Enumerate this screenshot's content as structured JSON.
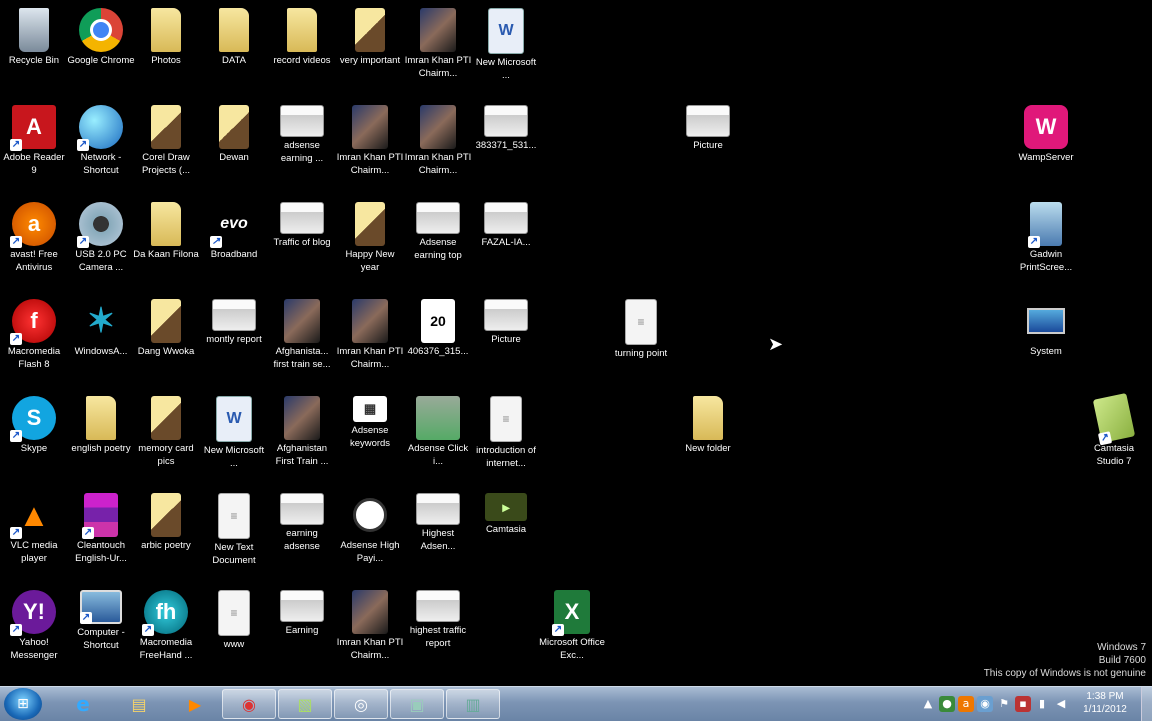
{
  "desktop": {
    "icons": [
      {
        "label": "Recycle Bin",
        "icon": "recycle-bin-icon"
      },
      {
        "label": "Google Chrome",
        "icon": "chrome-icon"
      },
      {
        "label": "Photos",
        "icon": "folder-icon"
      },
      {
        "label": "DATA",
        "icon": "folder-icon"
      },
      {
        "label": "record videos",
        "icon": "folder-icon"
      },
      {
        "label": "very important",
        "icon": "folder-icon"
      },
      {
        "label": "Imran Khan PTI Chairm...",
        "icon": "photo-icon"
      },
      {
        "label": "New Microsoft ...",
        "icon": "word-document-icon"
      },
      {
        "label": "Adobe Reader 9",
        "icon": "acrobat-icon"
      },
      {
        "label": "Network - Shortcut",
        "icon": "network-icon"
      },
      {
        "label": "Corel Draw Projects (...",
        "icon": "folder-icon"
      },
      {
        "label": "Dewan",
        "icon": "folder-icon"
      },
      {
        "label": "adsense earning ...",
        "icon": "thumbnail-icon"
      },
      {
        "label": "Imran Khan PTI Chairm...",
        "icon": "photo-icon"
      },
      {
        "label": "Imran Khan PTI Chairm...",
        "icon": "photo-icon"
      },
      {
        "label": "383371_531...",
        "icon": "thumbnail-icon"
      },
      {
        "label": "avast! Free Antivirus",
        "icon": "avast-icon"
      },
      {
        "label": "USB 2.0 PC Camera ...",
        "icon": "webcam-icon"
      },
      {
        "label": "Da Kaan Filona",
        "icon": "folder-icon"
      },
      {
        "label": "Broadband",
        "icon": "evo-icon"
      },
      {
        "label": "Traffic of blog",
        "icon": "thumbnail-icon"
      },
      {
        "label": "Happy New year",
        "icon": "folder-icon"
      },
      {
        "label": "Adsense earning top",
        "icon": "thumbnail-icon"
      },
      {
        "label": "FAZAL-IA...",
        "icon": "thumbnail-icon"
      },
      {
        "label": "Macromedia Flash 8",
        "icon": "flash-icon"
      },
      {
        "label": "WindowsA...",
        "icon": "star-icon"
      },
      {
        "label": "Dang Wwoka",
        "icon": "folder-icon"
      },
      {
        "label": "montly report",
        "icon": "thumbnail-icon"
      },
      {
        "label": "Afghanista... first train se...",
        "icon": "photo-icon"
      },
      {
        "label": "Imran Khan PTI Chairm...",
        "icon": "photo-icon"
      },
      {
        "label": "406376_315...",
        "icon": "image-2016-icon"
      },
      {
        "label": "Picture",
        "icon": "thumbnail-icon"
      },
      {
        "label": "Skype",
        "icon": "skype-icon"
      },
      {
        "label": "english poetry",
        "icon": "folder-icon"
      },
      {
        "label": "memory card pics",
        "icon": "folder-icon"
      },
      {
        "label": "New Microsoft ...",
        "icon": "word-document-icon"
      },
      {
        "label": "Afghanistan First Train ...",
        "icon": "photo-icon"
      },
      {
        "label": "Adsense keywords",
        "icon": "thumbnail-icon"
      },
      {
        "label": "Adsense Click i...",
        "icon": "money-icon"
      },
      {
        "label": "introduction of internet...",
        "icon": "document-icon"
      },
      {
        "label": "VLC media player",
        "icon": "vlc-icon"
      },
      {
        "label": "Cleantouch English-Ur...",
        "icon": "books-icon"
      },
      {
        "label": "arbic poetry",
        "icon": "folder-icon"
      },
      {
        "label": "New Text Document",
        "icon": "document-icon"
      },
      {
        "label": "earning adsense",
        "icon": "thumbnail-icon"
      },
      {
        "label": "Adsense High Payi...",
        "icon": "search-icon"
      },
      {
        "label": "Highest Adsen...",
        "icon": "thumbnail-icon"
      },
      {
        "label": "Camtasia",
        "icon": "camtasia-icon"
      },
      {
        "label": "Yahoo! Messenger",
        "icon": "yahoo-icon"
      },
      {
        "label": "Computer - Shortcut",
        "icon": "computer-icon"
      },
      {
        "label": "Macromedia FreeHand ...",
        "icon": "freehand-icon"
      },
      {
        "label": "www",
        "icon": "document-icon"
      },
      {
        "label": "Earning",
        "icon": "thumbnail-icon"
      },
      {
        "label": "Imran Khan PTI Chairm...",
        "icon": "photo-icon"
      },
      {
        "label": "highest traffic report",
        "icon": "thumbnail-icon"
      },
      {
        "label": "Microsoft Office Exc...",
        "icon": "excel-icon"
      },
      {
        "label": "Picture",
        "icon": "thumbnail-icon"
      },
      {
        "label": "turning point",
        "icon": "document-icon"
      },
      {
        "label": "New folder",
        "icon": "folder-icon"
      },
      {
        "label": "WampServer",
        "icon": "wamp-icon"
      },
      {
        "label": "Gadwin PrintScree...",
        "icon": "gadwin-icon"
      },
      {
        "label": "System",
        "icon": "laptop-icon"
      },
      {
        "label": "Camtasia Studio 7",
        "icon": "camstudio-icon"
      }
    ]
  },
  "watermark": {
    "line1": "Windows 7",
    "line2": "Build 7600",
    "line3": "This copy of Windows is not genuine"
  },
  "taskbar": {
    "pinned": [
      {
        "name": "internet-explorer-icon",
        "glyph": "e"
      },
      {
        "name": "explorer-icon",
        "glyph": "▤"
      },
      {
        "name": "media-player-icon",
        "glyph": "▶"
      },
      {
        "name": "chrome-icon",
        "glyph": "◉"
      },
      {
        "name": "notes-icon",
        "glyph": "▧"
      },
      {
        "name": "camtasia-recorder-icon",
        "glyph": "◎"
      },
      {
        "name": "app-icon",
        "glyph": "▣"
      },
      {
        "name": "gadwin-icon",
        "glyph": "▥"
      }
    ],
    "clock": {
      "time": "1:38 PM",
      "date": "1/11/2012"
    }
  }
}
